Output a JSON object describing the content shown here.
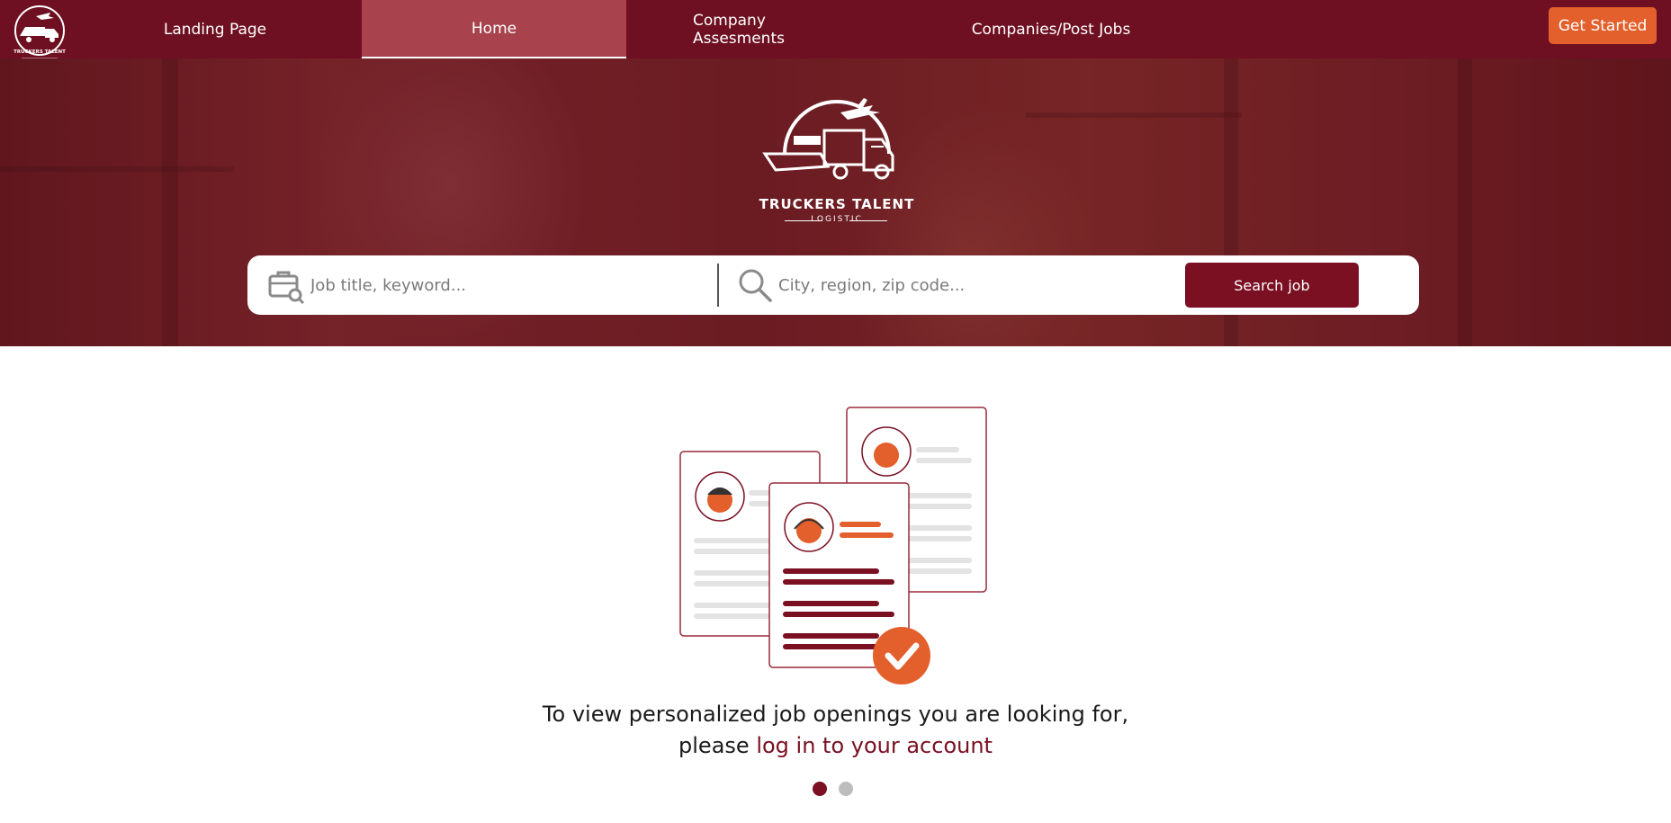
{
  "nav": {
    "logo_text": "TRUCKERS TALENT",
    "items": [
      {
        "label": "Landing Page"
      },
      {
        "label": "Home"
      },
      {
        "label": "Company Assesments"
      },
      {
        "label": "Companies/Post Jobs"
      }
    ],
    "active_index": 1,
    "cta_label": "Get Started"
  },
  "hero": {
    "brand": "TRUCKERS TALENT",
    "tagline": "LOGISTIC"
  },
  "search": {
    "job_placeholder": "Job title, keyword...",
    "location_placeholder": "City, region, zip code...",
    "button_label": "Search job",
    "job_icon": "briefcase-search-icon",
    "location_icon": "search-icon"
  },
  "message": {
    "line1": "To view personalized job openings you are looking for,",
    "line2_prefix": "please ",
    "line2_link": "log in to your account"
  },
  "carousel": {
    "count": 2,
    "active": 0
  },
  "colors": {
    "brand": "#6e1021",
    "active_tab": "#a8434d",
    "accent": "#e35f2b",
    "button": "#7a1022",
    "dot_inactive": "#bdbdbd"
  }
}
